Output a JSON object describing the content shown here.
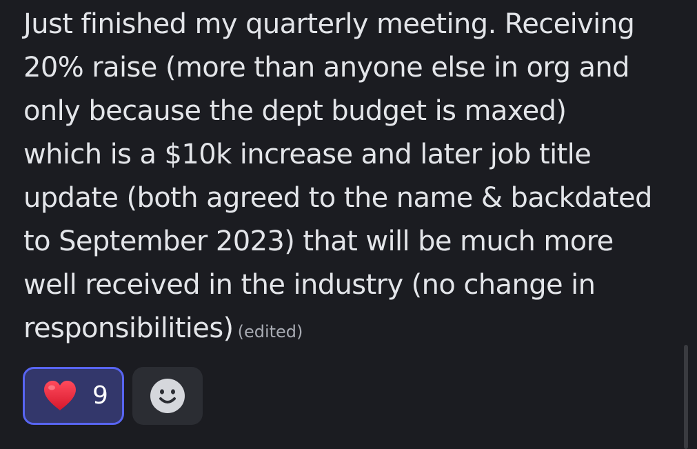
{
  "message": {
    "lines": [
      "Just finished my quarterly meeting. Receiving",
      "20% raise (more than anyone else in org and",
      "only because the dept budget is maxed)",
      "which is a $10k increase and later job title",
      "update (both agreed to the name & backdated",
      "to September 2023) that will be much more",
      "well received in the industry (no change in",
      "responsibilities)"
    ],
    "edited_label": "(edited)"
  },
  "reactions": [
    {
      "icon": "heart-emoji-icon",
      "count": "9",
      "selected": true
    }
  ],
  "add_reaction": {
    "icon": "smiley-face-icon"
  },
  "colors": {
    "background": "#1b1c21",
    "text": "#e3e5e9",
    "edited": "#a8abb3",
    "reaction_border": "#5865f2",
    "reaction_fill": "#33376b",
    "add_button": "#2b2d33",
    "heart": "#e0243a"
  }
}
